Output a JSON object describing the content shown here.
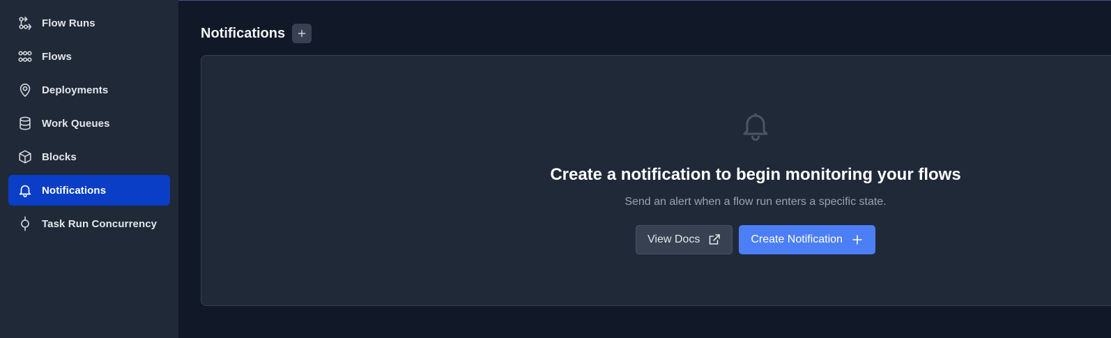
{
  "sidebar": {
    "items": [
      {
        "label": "Flow Runs",
        "icon": "flow-runs-icon",
        "active": false
      },
      {
        "label": "Flows",
        "icon": "flows-icon",
        "active": false
      },
      {
        "label": "Deployments",
        "icon": "map-pin-icon",
        "active": false
      },
      {
        "label": "Work Queues",
        "icon": "database-icon",
        "active": false
      },
      {
        "label": "Blocks",
        "icon": "cube-icon",
        "active": false
      },
      {
        "label": "Notifications",
        "icon": "bell-icon",
        "active": true
      },
      {
        "label": "Task Run Concurrency",
        "icon": "concurrency-icon",
        "active": false
      }
    ]
  },
  "header": {
    "title": "Notifications",
    "add_icon": "plus-icon"
  },
  "empty_state": {
    "icon": "bell-icon",
    "title": "Create a notification to begin monitoring your flows",
    "subtitle": "Send an alert when a flow run enters a specific state.",
    "view_docs_label": "View Docs",
    "view_docs_icon": "external-link-icon",
    "create_label": "Create Notification",
    "create_icon": "plus-icon"
  },
  "colors": {
    "background": "#111827",
    "sidebar": "#1f2937",
    "active_item": "#0a3ec6",
    "primary_button": "#4c7ff6",
    "card": "#1f2937"
  }
}
